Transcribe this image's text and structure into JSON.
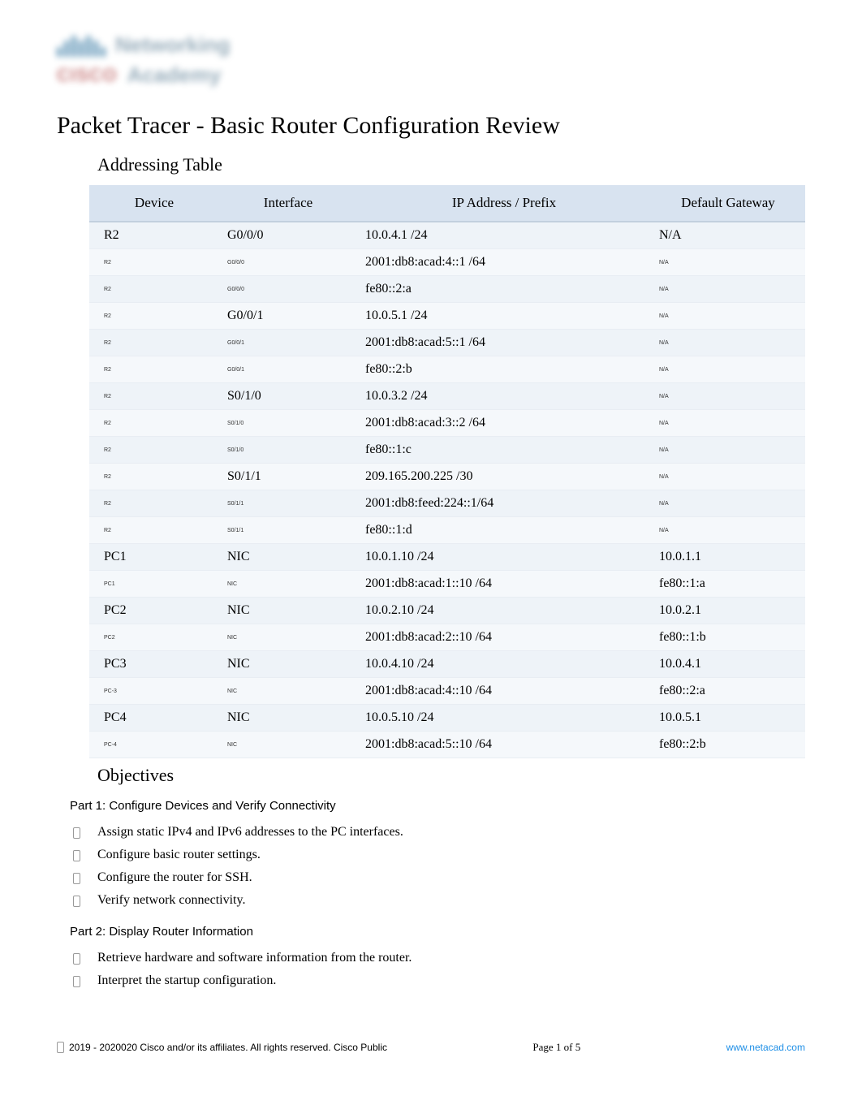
{
  "logo": {
    "word1": "Networking",
    "word2": "CISCO",
    "word3": "Academy"
  },
  "title": "Packet Tracer - Basic Router Configuration Review",
  "sections": {
    "addressing_table": "Addressing Table",
    "objectives": "Objectives"
  },
  "table": {
    "headers": [
      "Device",
      "Interface",
      "IP Address / Prefix",
      "Default Gateway"
    ],
    "rows": [
      {
        "device": "R2",
        "dev_tiny": false,
        "iface": "G0/0/0",
        "iface_tiny": false,
        "ip": "10.0.4.1 /24",
        "gw": "N/A",
        "gw_tiny": false
      },
      {
        "device": "R2",
        "dev_tiny": true,
        "iface": "G0/0/0",
        "iface_tiny": true,
        "ip": "2001:db8:acad:4::1 /64",
        "gw": "N/A",
        "gw_tiny": true
      },
      {
        "device": "R2",
        "dev_tiny": true,
        "iface": "G0/0/0",
        "iface_tiny": true,
        "ip": "fe80::2:a",
        "gw": "N/A",
        "gw_tiny": true
      },
      {
        "device": "R2",
        "dev_tiny": true,
        "iface": "G0/0/1",
        "iface_tiny": false,
        "ip": "10.0.5.1 /24",
        "gw": "N/A",
        "gw_tiny": true
      },
      {
        "device": "R2",
        "dev_tiny": true,
        "iface": "G0/0/1",
        "iface_tiny": true,
        "ip": "2001:db8:acad:5::1 /64",
        "gw": "N/A",
        "gw_tiny": true
      },
      {
        "device": "R2",
        "dev_tiny": true,
        "iface": "G0/0/1",
        "iface_tiny": true,
        "ip": "fe80::2:b",
        "gw": "N/A",
        "gw_tiny": true
      },
      {
        "device": "R2",
        "dev_tiny": true,
        "iface": "S0/1/0",
        "iface_tiny": false,
        "ip": "10.0.3.2 /24",
        "gw": "N/A",
        "gw_tiny": true
      },
      {
        "device": "R2",
        "dev_tiny": true,
        "iface": "S0/1/0",
        "iface_tiny": true,
        "ip": "2001:db8:acad:3::2 /64",
        "gw": "N/A",
        "gw_tiny": true
      },
      {
        "device": "R2",
        "dev_tiny": true,
        "iface": "S0/1/0",
        "iface_tiny": true,
        "ip": "fe80::1:c",
        "gw": "N/A",
        "gw_tiny": true
      },
      {
        "device": "R2",
        "dev_tiny": true,
        "iface": "S0/1/1",
        "iface_tiny": false,
        "ip": "209.165.200.225 /30",
        "gw": "N/A",
        "gw_tiny": true
      },
      {
        "device": "R2",
        "dev_tiny": true,
        "iface": "S0/1/1",
        "iface_tiny": true,
        "ip": "2001:db8:feed:224::1/64",
        "gw": "N/A",
        "gw_tiny": true
      },
      {
        "device": "R2",
        "dev_tiny": true,
        "iface": "S0/1/1",
        "iface_tiny": true,
        "ip": "fe80::1:d",
        "gw": "N/A",
        "gw_tiny": true
      },
      {
        "device": "PC1",
        "dev_tiny": false,
        "iface": "NIC",
        "iface_tiny": false,
        "ip": "10.0.1.10 /24",
        "gw": "10.0.1.1",
        "gw_tiny": false
      },
      {
        "device": "PC1",
        "dev_tiny": true,
        "iface": "NIC",
        "iface_tiny": true,
        "ip": "2001:db8:acad:1::10 /64",
        "gw": "fe80::1:a",
        "gw_tiny": false
      },
      {
        "device": "PC2",
        "dev_tiny": false,
        "iface": "NIC",
        "iface_tiny": false,
        "ip": "10.0.2.10 /24",
        "gw": "10.0.2.1",
        "gw_tiny": false
      },
      {
        "device": "PC2",
        "dev_tiny": true,
        "iface": "NIC",
        "iface_tiny": true,
        "ip": "2001:db8:acad:2::10 /64",
        "gw": "fe80::1:b",
        "gw_tiny": false
      },
      {
        "device": "PC3",
        "dev_tiny": false,
        "iface": "NIC",
        "iface_tiny": false,
        "ip": "10.0.4.10 /24",
        "gw": "10.0.4.1",
        "gw_tiny": false
      },
      {
        "device": "PC-3",
        "dev_tiny": true,
        "iface": "NIC",
        "iface_tiny": true,
        "ip": "2001:db8:acad:4::10 /64",
        "gw": "fe80::2:a",
        "gw_tiny": false
      },
      {
        "device": "PC4",
        "dev_tiny": false,
        "iface": "NIC",
        "iface_tiny": false,
        "ip": "10.0.5.10 /24",
        "gw": "10.0.5.1",
        "gw_tiny": false
      },
      {
        "device": "PC-4",
        "dev_tiny": true,
        "iface": "NIC",
        "iface_tiny": true,
        "ip": "2001:db8:acad:5::10 /64",
        "gw": "fe80::2:b",
        "gw_tiny": false
      }
    ]
  },
  "objectives": {
    "part1": {
      "label": "Part 1: Configure Devices and Verify Connectivity",
      "items": [
        "Assign static IPv4 and IPv6 addresses to the PC interfaces.",
        "Configure basic router settings.",
        "Configure the router for SSH.",
        "Verify network connectivity."
      ]
    },
    "part2": {
      "label": "Part 2: Display Router Information",
      "items": [
        "Retrieve hardware and software information from the router.",
        "Interpret the startup configuration."
      ]
    }
  },
  "footer": {
    "copyright": "2019 - 2020020 Cisco and/or its affiliates. All rights reserved. Cisco Public",
    "page": "Page  1 of 5",
    "url": "www.netacad.com"
  }
}
